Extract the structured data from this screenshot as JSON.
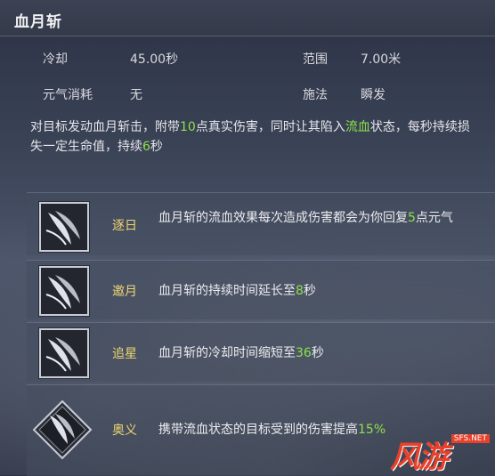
{
  "skill": {
    "title": "血月斩",
    "stats": {
      "cooldown_label": "冷却",
      "cooldown_value": "45.00秒",
      "range_label": "范围",
      "range_value": "7.00米",
      "cost_label": "元气消耗",
      "cost_value": "无",
      "cast_label": "施法",
      "cast_value": "瞬发"
    },
    "description": {
      "p1": "对目标发动血月斩击，附带",
      "v1": "10",
      "p2": "点真实伤害，同时让其陷入",
      "v2": "流血",
      "p3": "状态，每秒持续损失一定生命值，持续",
      "v3": "6",
      "p4": "秒"
    }
  },
  "upgrades": [
    {
      "name": "逐日",
      "text_a": "血月斩的流血效果每次造成伤害都会为你回复",
      "value": "5",
      "text_b": "点元气"
    },
    {
      "name": "邀月",
      "text_a": "血月斩的持续时间延长至",
      "value": "8",
      "text_b": "秒"
    },
    {
      "name": "追星",
      "text_a": "血月斩的冷却时间缩短至",
      "value": "36",
      "text_b": "秒"
    },
    {
      "name": "奥义",
      "text_a": "携带流血状态的目标受到的伤害提高",
      "value": "15%",
      "text_b": ""
    }
  ],
  "watermark": {
    "logo": "风游",
    "site": "SFS.NET"
  },
  "colors": {
    "highlight": "#8fe04a",
    "upgrade_name": "#f0d770",
    "watermark": "#e8402a"
  }
}
